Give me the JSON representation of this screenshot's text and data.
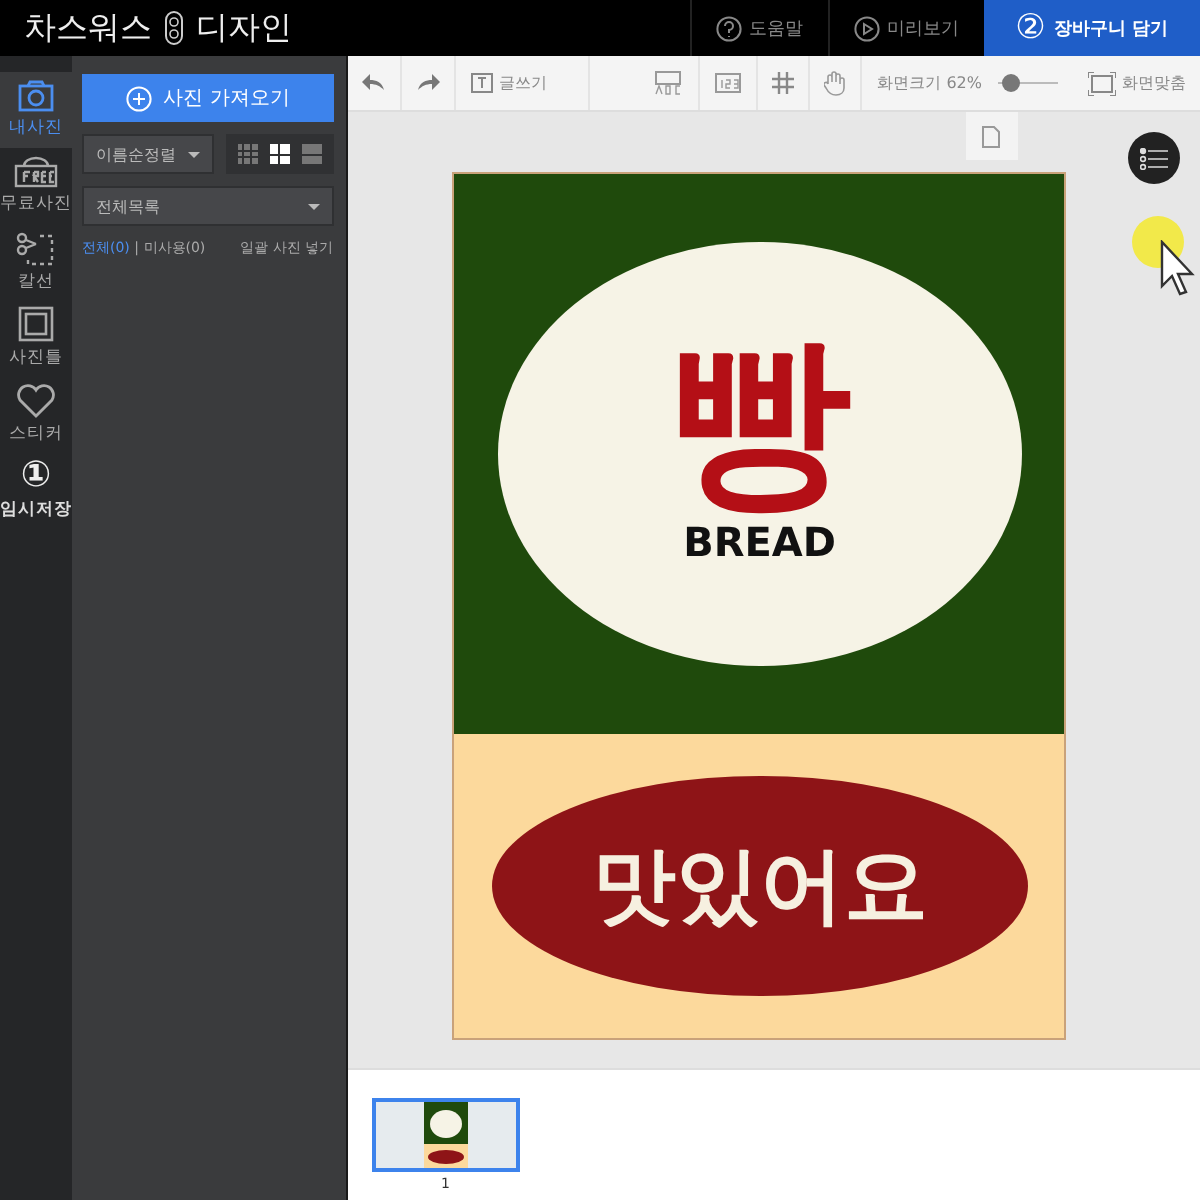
{
  "header": {
    "logo_left": "차스워스",
    "logo_right": "디자인",
    "help": "도움말",
    "preview": "미리보기",
    "cart_step": "②",
    "cart": "장바구니 담기"
  },
  "rail": [
    {
      "label": "내사진",
      "selected": true
    },
    {
      "label": "무료사진",
      "selected": false
    },
    {
      "label": "칼선",
      "selected": false
    },
    {
      "label": "사진틀",
      "selected": false
    },
    {
      "label": "스티커",
      "selected": false
    },
    {
      "label": "임시저장",
      "badge": "①",
      "selected": false
    }
  ],
  "panel": {
    "import_button": "사진 가져오기",
    "sort": "이름순정렬",
    "views": [
      {
        "kind": "small",
        "selected": false
      },
      {
        "kind": "grid",
        "selected": true
      },
      {
        "kind": "list",
        "selected": false
      }
    ],
    "filter": "전체목록",
    "all": "전체(0)",
    "separator": "|",
    "unused": "미사용(0)",
    "bulk": "일괄 사진 넣기"
  },
  "toolbar": {
    "write": "글쓰기",
    "zoom_label": "화면크기 62%",
    "zoom": {
      "level": 0.2
    },
    "fit": "화면맞춤"
  },
  "poster": {
    "title": "빵",
    "subtitle": "BREAD",
    "slogan": "맛있어요"
  },
  "pages": [
    {
      "number": "1",
      "selected": true
    }
  ]
}
